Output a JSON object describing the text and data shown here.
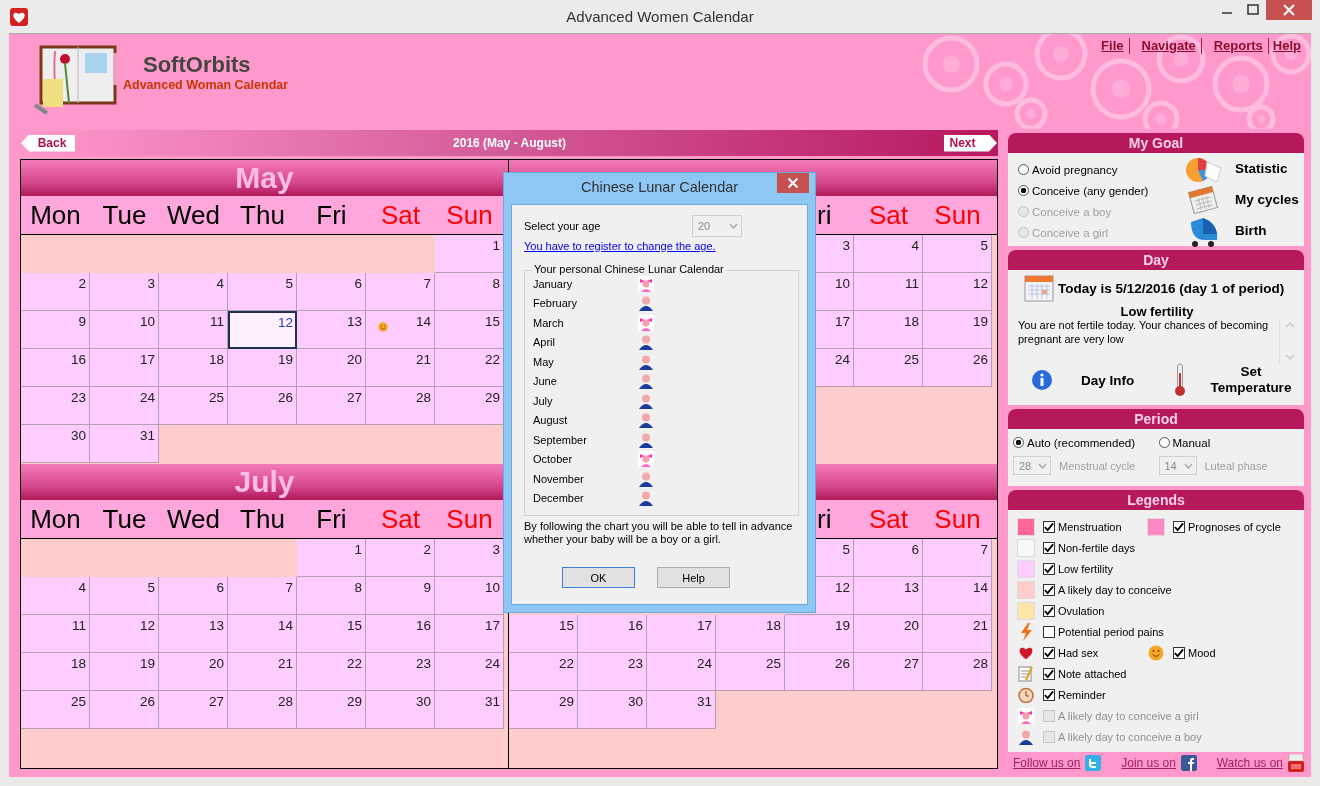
{
  "window": {
    "title": "Advanced Women Calendar"
  },
  "brand": {
    "name": "SoftOrbits",
    "product": "Advanced Woman Calendar"
  },
  "menu": [
    "File",
    "Navigate",
    "Reports",
    "Help"
  ],
  "navigation": {
    "back": "Back",
    "title": "2016 (May - August)",
    "next": "Next"
  },
  "months": [
    {
      "title": "May",
      "weekdays": [
        {
          "kind": "full",
          "label": "Mon",
          "weekend": false
        },
        {
          "kind": "full",
          "label": "Tue",
          "weekend": false
        },
        {
          "kind": "full",
          "label": "Wed",
          "weekend": false
        },
        {
          "kind": "full",
          "label": "Thu",
          "weekend": false
        },
        {
          "kind": "full",
          "label": "Fri",
          "weekend": false
        },
        {
          "kind": "full",
          "label": "Sat",
          "weekend": true
        },
        {
          "kind": "full",
          "label": "Sun",
          "weekend": true
        }
      ],
      "weeks": [
        [
          {
            "kind": "blank"
          },
          {
            "kind": "blank"
          },
          {
            "kind": "blank"
          },
          {
            "kind": "blank"
          },
          {
            "kind": "blank"
          },
          {
            "kind": "blank"
          },
          "1"
        ],
        [
          "2",
          "3",
          "4",
          "5",
          "6",
          "7",
          "8"
        ],
        [
          "9",
          "10",
          "11",
          {
            "day": "12",
            "selected": true,
            "mood": false
          },
          "13",
          {
            "day": "14",
            "selected": false,
            "mood": true
          },
          "15"
        ],
        [
          "16",
          "17",
          "18",
          "19",
          "20",
          "21",
          "22"
        ],
        [
          "23",
          "24",
          "25",
          "26",
          "27",
          "28",
          "29"
        ],
        [
          "30",
          "31"
        ]
      ]
    },
    {
      "weekdays": [
        {
          "kind": "hidden"
        },
        {
          "kind": "hidden"
        },
        {
          "kind": "hidden"
        },
        {
          "kind": "hidden"
        },
        {
          "kind": "partial",
          "label": "ri",
          "weekend": false
        },
        {
          "kind": "full",
          "label": "Sat",
          "weekend": true
        },
        {
          "kind": "full",
          "label": "Sun",
          "weekend": true
        }
      ],
      "weeks": [
        [
          {
            "kind": "blank"
          },
          {
            "kind": "blank"
          },
          {
            "kind": "blank"
          },
          {
            "kind": "blank"
          },
          "3",
          "4",
          "5"
        ],
        [
          {
            "kind": "blank"
          },
          {
            "kind": "blank"
          },
          {
            "kind": "blank"
          },
          {
            "kind": "blank"
          },
          "10",
          "11",
          "12"
        ],
        [
          {
            "kind": "blank"
          },
          {
            "kind": "blank"
          },
          {
            "kind": "blank"
          },
          {
            "kind": "blank"
          },
          "17",
          "18",
          "19"
        ],
        [
          {
            "kind": "blank"
          },
          {
            "kind": "blank"
          },
          {
            "kind": "blank"
          },
          {
            "kind": "blank"
          },
          "24",
          "25",
          "26"
        ]
      ]
    },
    {
      "title": "July",
      "weekdays": [
        {
          "kind": "full",
          "label": "Mon",
          "weekend": false
        },
        {
          "kind": "full",
          "label": "Tue",
          "weekend": false
        },
        {
          "kind": "full",
          "label": "Wed",
          "weekend": false
        },
        {
          "kind": "full",
          "label": "Thu",
          "weekend": false
        },
        {
          "kind": "full",
          "label": "Fri",
          "weekend": false
        },
        {
          "kind": "full",
          "label": "Sat",
          "weekend": true
        },
        {
          "kind": "full",
          "label": "Sun",
          "weekend": true
        }
      ],
      "weeks": [
        [
          {
            "kind": "blank"
          },
          {
            "kind": "blank"
          },
          {
            "kind": "blank"
          },
          {
            "kind": "blank"
          },
          "1",
          "2",
          "3"
        ],
        [
          "4",
          "5",
          "6",
          "7",
          "8",
          "9",
          "10"
        ],
        [
          "11",
          "12",
          "13",
          "14",
          "15",
          "16",
          "17"
        ],
        [
          "18",
          "19",
          "20",
          "21",
          "22",
          "23",
          "24"
        ],
        [
          "25",
          "26",
          "27",
          "28",
          "29",
          "30",
          "31"
        ]
      ]
    },
    {
      "weekdays": [
        {
          "kind": "hidden"
        },
        {
          "kind": "hidden"
        },
        {
          "kind": "hidden"
        },
        {
          "kind": "hidden"
        },
        {
          "kind": "partial",
          "label": "ri",
          "weekend": false
        },
        {
          "kind": "full",
          "label": "Sat",
          "weekend": true
        },
        {
          "kind": "full",
          "label": "Sun",
          "weekend": true
        }
      ],
      "weeks": [
        [
          {
            "kind": "blank"
          },
          {
            "kind": "blank"
          },
          {
            "kind": "blank"
          },
          {
            "kind": "blank"
          },
          "5",
          "6",
          "7"
        ],
        [
          {
            "kind": "blank"
          },
          {
            "kind": "blank"
          },
          {
            "kind": "blank"
          },
          {
            "kind": "blank"
          },
          "12",
          "13",
          "14"
        ],
        [
          "15",
          "16",
          "17",
          "18",
          "19",
          "20",
          "21"
        ],
        [
          "22",
          "23",
          "24",
          "25",
          "26",
          "27",
          "28"
        ],
        [
          "29",
          "30",
          "31"
        ]
      ]
    }
  ],
  "my_goal": {
    "title": "My Goal",
    "options": [
      {
        "label": "Avoid pregnancy",
        "selected": false,
        "disabled": false
      },
      {
        "label": "Conceive (any gender)",
        "selected": true,
        "disabled": false
      },
      {
        "label": "Conceive a boy",
        "selected": false,
        "disabled": true
      },
      {
        "label": "Conceive a girl",
        "selected": false,
        "disabled": true
      }
    ],
    "actions": [
      {
        "label": "Statistic",
        "kind": "chart"
      },
      {
        "label": "My cycles",
        "kind": "calendar"
      },
      {
        "label": "Birth",
        "kind": "stroller"
      }
    ]
  },
  "day": {
    "title": "Day",
    "today": "Today is 5/12/2016 (day 1 of period)",
    "status": "Low fertility",
    "description": "You are not fertile today. Your chances of becoming pregnant are very low",
    "actions": [
      {
        "label": "Day Info",
        "kind": "info"
      },
      {
        "label": "Set Temperature",
        "kind": "thermometer"
      }
    ]
  },
  "period": {
    "title": "Period",
    "modes": [
      {
        "label": "Auto (recommended)",
        "selected": true
      },
      {
        "label": "Manual",
        "selected": false
      }
    ],
    "settings": [
      {
        "value": "28",
        "label": "Menstrual cycle"
      },
      {
        "value": "14",
        "label": "Luteal phase"
      }
    ]
  },
  "legends": {
    "title": "Legends",
    "rows": [
      [
        {
          "kind": "swatch",
          "color": "#ff6699",
          "label": "Menstruation",
          "checked": true,
          "disabled": false
        },
        {
          "kind": "swatch",
          "color": "#ff88c4",
          "label": "Prognoses of cycle",
          "checked": true,
          "disabled": false
        }
      ],
      [
        {
          "kind": "swatch",
          "color": "#f8f8f8",
          "label": "Non-fertile days",
          "checked": true,
          "disabled": false
        }
      ],
      [
        {
          "kind": "swatch",
          "color": "#ffccff",
          "label": "Low fertility",
          "checked": true,
          "disabled": false
        }
      ],
      [
        {
          "kind": "swatch",
          "color": "#ffcccc",
          "label": "A likely day to conceive",
          "checked": true,
          "disabled": false
        }
      ],
      [
        {
          "kind": "swatch",
          "color": "#ffe4a8",
          "label": "Ovulation",
          "checked": true,
          "disabled": false
        }
      ],
      [
        {
          "kind": "lightning",
          "label": "Potential period pains",
          "checked": false,
          "disabled": false
        }
      ],
      [
        {
          "kind": "heart",
          "label": "Had sex",
          "checked": true,
          "disabled": false
        },
        {
          "kind": "smiley",
          "label": "Mood",
          "checked": true,
          "disabled": false
        }
      ],
      [
        {
          "kind": "note",
          "label": "Note attached",
          "checked": true,
          "disabled": false
        }
      ],
      [
        {
          "kind": "clock",
          "label": "Reminder",
          "checked": true,
          "disabled": false
        }
      ],
      [
        {
          "kind": "girl",
          "label": "A likely day to conceive a girl",
          "checked": false,
          "disabled": true
        }
      ],
      [
        {
          "kind": "boy",
          "label": "A likely day to conceive a boy",
          "checked": false,
          "disabled": true
        }
      ]
    ]
  },
  "footer_links": [
    {
      "label": "Follow us on",
      "kind": "twitter"
    },
    {
      "label": "Join us on",
      "kind": "facebook"
    },
    {
      "label": "Watch us on",
      "kind": "youtube"
    }
  ],
  "dialog": {
    "title": "Chinese Lunar Calendar",
    "age_label": "Select your age",
    "age": "20",
    "register_link": "You have to register to change the age.",
    "group_title": "Your personal Chinese Lunar Calendar",
    "months": [
      {
        "name": "January",
        "kind": "girl"
      },
      {
        "name": "February",
        "kind": "boy"
      },
      {
        "name": "March",
        "kind": "girl"
      },
      {
        "name": "April",
        "kind": "boy"
      },
      {
        "name": "May",
        "kind": "boy"
      },
      {
        "name": "June",
        "kind": "boy"
      },
      {
        "name": "July",
        "kind": "boy"
      },
      {
        "name": "August",
        "kind": "boy"
      },
      {
        "name": "September",
        "kind": "boy"
      },
      {
        "name": "October",
        "kind": "girl"
      },
      {
        "name": "November",
        "kind": "boy"
      },
      {
        "name": "December",
        "kind": "boy"
      }
    ],
    "note": "By following the chart you will be able to tell in advance whether your baby will be a boy or a girl.",
    "buttons": [
      {
        "label": "OK",
        "focused": true
      },
      {
        "label": "Help",
        "focused": false
      }
    ]
  }
}
